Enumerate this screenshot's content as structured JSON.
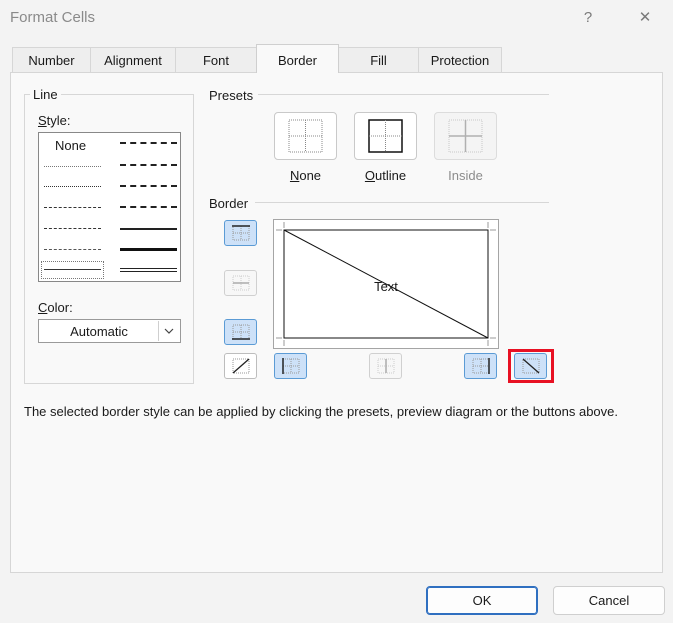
{
  "window": {
    "title": "Format Cells",
    "help_glyph": "?",
    "close_glyph": "✕"
  },
  "tabs": [
    "Number",
    "Alignment",
    "Font",
    "Border",
    "Fill",
    "Protection"
  ],
  "active_tab": "Border",
  "line": {
    "group_label": "Line",
    "style_label": "Style:",
    "none_label": "None",
    "color_label": "Color:",
    "color_value": "Automatic"
  },
  "presets": {
    "group_label": "Presets",
    "items": [
      {
        "label": "None",
        "mnemonic": "N",
        "rest": "one",
        "enabled": true
      },
      {
        "label": "Outline",
        "mnemonic": "O",
        "rest": "utline",
        "enabled": true
      },
      {
        "label": "Inside",
        "enabled": false
      }
    ]
  },
  "border": {
    "group_label": "Border",
    "preview_text": "Text",
    "highlight_color": "#e81123"
  },
  "hint": "The selected border style can be applied by clicking the presets, preview diagram or the buttons above.",
  "buttons": {
    "ok": "OK",
    "cancel": "Cancel"
  }
}
